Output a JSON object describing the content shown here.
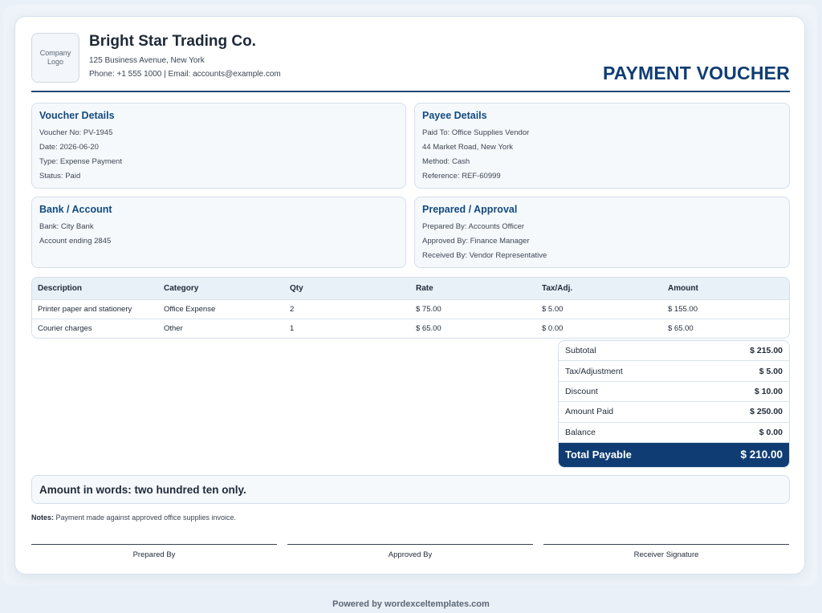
{
  "header": {
    "logo_text": "Company Logo",
    "company_name": "Bright Star Trading Co.",
    "address": "125 Business Avenue, New York",
    "contact": "Phone: +1 555 1000 | Email: accounts@example.com",
    "title": "PAYMENT VOUCHER"
  },
  "voucher_details": {
    "title": "Voucher Details",
    "lines": [
      "Voucher No: PV-1945",
      "Date: 2026-06-20",
      "Type: Expense Payment",
      "Status: Paid"
    ]
  },
  "payee_details": {
    "title": "Payee Details",
    "lines": [
      "Paid To: Office Supplies Vendor",
      "44 Market Road, New York",
      "Method: Cash",
      "Reference: REF-60999"
    ]
  },
  "bank_account": {
    "title": "Bank / Account",
    "lines": [
      "Bank: City Bank",
      "Account ending 2845"
    ]
  },
  "prepared_approval": {
    "title": "Prepared / Approval",
    "lines": [
      "Prepared By: Accounts Officer",
      "Approved By: Finance Manager",
      "Received By: Vendor Representative"
    ]
  },
  "items": {
    "columns": [
      "Description",
      "Category",
      "Qty",
      "Rate",
      "Tax/Adj.",
      "Amount"
    ],
    "rows": [
      [
        "Printer paper and stationery",
        "Office Expense",
        "2",
        "$ 75.00",
        "$ 5.00",
        "$ 155.00"
      ],
      [
        "Courier charges",
        "Other",
        "1",
        "$ 65.00",
        "$ 0.00",
        "$ 65.00"
      ]
    ]
  },
  "totals": {
    "rows": [
      {
        "label": "Subtotal",
        "value": "$ 215.00"
      },
      {
        "label": "Tax/Adjustment",
        "value": "$ 5.00"
      },
      {
        "label": "Discount",
        "value": "$ 10.00"
      },
      {
        "label": "Amount Paid",
        "value": "$ 250.00"
      },
      {
        "label": "Balance",
        "value": "$ 0.00"
      }
    ],
    "grand_label": "Total Payable",
    "grand_value": "$ 210.00"
  },
  "amount_in_words": "Amount in words: two hundred ten only.",
  "notes": {
    "label": "Notes:",
    "text": "Payment made against approved office supplies invoice."
  },
  "signatures": [
    "Prepared By",
    "Approved By",
    "Receiver Signature"
  ],
  "footer": "Powered by wordexceltemplates.com",
  "colors": {
    "accent": "#0f3d73",
    "heading": "#124a80",
    "card_bg": "#f6f9fc"
  }
}
